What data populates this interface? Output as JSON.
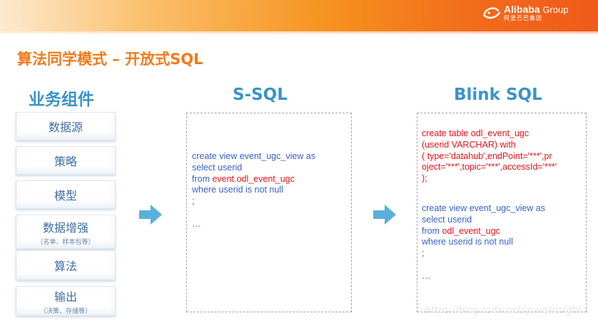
{
  "header": {
    "brand_main": "Alibaba",
    "brand_group": "Group",
    "brand_sub": "阿里巴巴集团",
    "logo_icon": "alibaba-smile-icon"
  },
  "slide": {
    "title": "算法同学模式 – 开放式SQL"
  },
  "columns": {
    "business": "业务组件",
    "ssql": "S-SQL",
    "blink": "Blink SQL"
  },
  "components": [
    {
      "label": "数据源"
    },
    {
      "label": "策略"
    },
    {
      "label": "模型"
    },
    {
      "label": "数据增强",
      "sub": "（名单、样本包等）"
    },
    {
      "label": "算法"
    },
    {
      "label": "输出",
      "sub": "（决策、存储等）"
    }
  ],
  "ssql_code": {
    "l1": "create view event_ugc_view as",
    "l2": "select userid",
    "l3_kw": "from ",
    "l3_id": "event.odl_event_ugc",
    "l4": "where userid is not null",
    "l5": ";",
    "l6": "…"
  },
  "blink_code": {
    "l1": "create table odl_event_ugc",
    "l2": "(userid VARCHAR) with",
    "l3": "(  type='datahub',endPoint='***',pr",
    "l4": "oject='***',topic='***',accessId='***'",
    "l5": ");",
    "m1": "create view event_ugc_view as",
    "m2": "select userid",
    "m3_kw": "from ",
    "m3_id": "odl_event_ugc",
    "m4": "where userid is not null",
    "m5": ";",
    "m6": "…"
  },
  "watermark": "https://blog.csdn.net/yunqiinsight",
  "colors": {
    "title_orange": "#f27a1a",
    "header_blue": "#3a93c9",
    "code_blue": "#3a63c4",
    "code_red": "#e5131b",
    "arrow_blue": "#5ab0dc"
  }
}
